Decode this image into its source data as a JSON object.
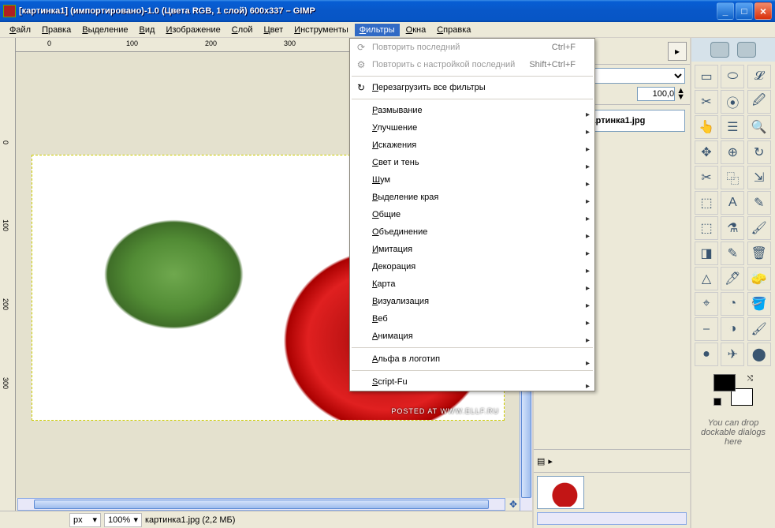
{
  "titlebar": {
    "title": "[картинка1] (импортировано)-1.0 (Цвета RGB, 1 слой) 600x337 – GIMP"
  },
  "menubar": {
    "items": [
      {
        "label": "Файл",
        "u": "Ф"
      },
      {
        "label": "Правка",
        "u": "П"
      },
      {
        "label": "Выделение",
        "u": "В"
      },
      {
        "label": "Вид",
        "u": "В"
      },
      {
        "label": "Изображение",
        "u": "И"
      },
      {
        "label": "Слой",
        "u": "С"
      },
      {
        "label": "Цвет",
        "u": "Ц"
      },
      {
        "label": "Инструменты",
        "u": "И"
      },
      {
        "label": "Фильтры",
        "u": "Ф",
        "open": true
      },
      {
        "label": "Окна",
        "u": "О"
      },
      {
        "label": "Справка",
        "u": "С"
      }
    ]
  },
  "dropdown": {
    "items": [
      {
        "label": "Повторить последний",
        "u": "",
        "accel": "Ctrl+F",
        "disabled": true,
        "icon": "⟳"
      },
      {
        "label": "Повторить с настройкой последний",
        "u": "",
        "accel": "Shift+Ctrl+F",
        "disabled": true,
        "icon": "⚙"
      },
      {
        "sep": true
      },
      {
        "label": "Перезагрузить все фильтры",
        "u": "П",
        "icon": "↻"
      },
      {
        "sep": true
      },
      {
        "label": "Размывание",
        "u": "Р",
        "sub": true
      },
      {
        "label": "Улучшение",
        "u": "У",
        "sub": true
      },
      {
        "label": "Искажения",
        "u": "И",
        "sub": true
      },
      {
        "label": "Свет и тень",
        "u": "С",
        "sub": true
      },
      {
        "label": "Шум",
        "u": "Ш",
        "sub": true
      },
      {
        "label": "Выделение края",
        "u": "В",
        "sub": true
      },
      {
        "label": "Общие",
        "u": "О",
        "sub": true
      },
      {
        "label": "Объединение",
        "u": "О",
        "sub": true
      },
      {
        "label": "Имитация",
        "u": "И",
        "sub": true
      },
      {
        "label": "Декорация",
        "u": "",
        "sub": true
      },
      {
        "label": "Карта",
        "u": "К",
        "sub": true
      },
      {
        "label": "Визуализация",
        "u": "В",
        "sub": true
      },
      {
        "label": "Веб",
        "u": "В",
        "sub": true
      },
      {
        "label": "Анимация",
        "u": "А",
        "sub": true
      },
      {
        "sep": true
      },
      {
        "label": "Альфа в логотип",
        "u": "А",
        "sub": true
      },
      {
        "sep": true
      },
      {
        "label": "Script-Fu",
        "u": "S",
        "sub": true
      }
    ]
  },
  "ruler": {
    "h": [
      "0",
      "100",
      "200",
      "300"
    ],
    "v": [
      "0",
      "100",
      "200",
      "300"
    ]
  },
  "watermark": "POSTED AT WWW.ELLF.RU",
  "statusbar": {
    "unit": "px",
    "zoom": "100%",
    "info": "картинка1.jpg (2,2 МБ)"
  },
  "layers": {
    "opacity": "100,0",
    "item_name": "картинка1.jpg"
  },
  "toolbox": {
    "hint": "You can drop dockable dialogs here",
    "tools": [
      "▭",
      "⬭",
      "𝓛",
      "✂",
      "⦿",
      "🖉",
      "👆",
      "☰",
      "🔍",
      "✥",
      "⊕",
      "↻",
      "✂",
      "⿻",
      "⇲",
      "⬚",
      "A",
      "✎",
      "⬚",
      "⚗",
      "🖌",
      "◨",
      "✎",
      "🗑",
      "△",
      "🖊",
      "🧽",
      "⌖",
      "◔",
      "🪣",
      "⎯",
      "◑",
      "🖌",
      "●",
      "✈",
      "⬤"
    ]
  }
}
